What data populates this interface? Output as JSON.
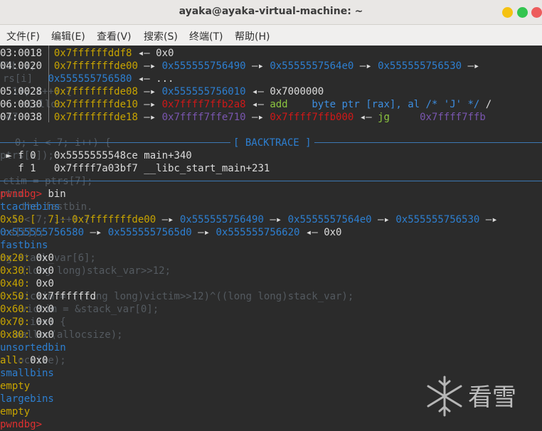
{
  "window": {
    "title": "ayaka@ayaka-virtual-machine: ~"
  },
  "menu": [
    "文件(F)",
    "编辑(E)",
    "查看(V)",
    "搜索(S)",
    "终端(T)",
    "帮助(H)"
  ],
  "stack": [
    {
      "off": "03:0018",
      "addr": "0x7ffffffddf8",
      "rest": [
        [
          "w",
          "◂— 0x0"
        ]
      ]
    },
    {
      "off": "04:0020",
      "addr": "0x7fffffffde00",
      "rest": [
        [
          "w",
          "—▸ "
        ],
        [
          "b",
          "0x555555756490"
        ],
        [
          "w",
          " —▸ "
        ],
        [
          "b",
          "0x5555557564e0"
        ],
        [
          "w",
          " —▸ "
        ],
        [
          "b",
          "0x555555756530"
        ],
        [
          "w",
          " —▸"
        ]
      ]
    },
    {
      "off": "",
      "addr": "",
      "rest": [
        [
          "b",
          "0x555555756580"
        ],
        [
          "w",
          " ◂— ..."
        ]
      ]
    },
    {
      "off": "05:0028",
      "addr": "0x7fffffffde08",
      "rest": [
        [
          "w",
          "—▸ "
        ],
        [
          "b",
          "0x555555756010"
        ],
        [
          "w",
          " ◂— 0x7000000"
        ]
      ]
    },
    {
      "off": "06:0030",
      "addr": "0x7fffffffde10",
      "rest": [
        [
          "w",
          "—▸ "
        ],
        [
          "r",
          "0x7ffff7ffb2a8"
        ],
        [
          "w",
          " ◂— "
        ],
        [
          "gr",
          "add"
        ],
        [
          "w",
          "    "
        ],
        [
          "bl",
          "byte ptr [rax], al /* 'J' */"
        ],
        [
          "w",
          " /"
        ]
      ]
    },
    {
      "off": "07:0038",
      "addr": "0x7fffffffde18",
      "rest": [
        [
          "w",
          "—▸ "
        ],
        [
          "m",
          "0x7ffff7ffe710"
        ],
        [
          "w",
          " —▸ "
        ],
        [
          "r",
          "0x7ffff7ffb000"
        ],
        [
          "w",
          " ◂— "
        ],
        [
          "gr",
          "jg"
        ],
        [
          "w",
          "     "
        ],
        [
          "m",
          "0x7ffff7ffb"
        ]
      ]
    }
  ],
  "backtrace": {
    "header": "[ BACKTRACE ]",
    "frames": [
      {
        "marker": "►",
        "idx": "f 0",
        "addr": "0x5555555548ce",
        "sym": "main+340"
      },
      {
        "marker": "",
        "idx": "f 1",
        "addr": "0x7ffff7a03bf7",
        "sym": "__libc_start_main+231"
      }
    ]
  },
  "prompt": "pwndbg>",
  "command": "bin",
  "tcache": {
    "header": "tcachebins",
    "line1": [
      [
        "y",
        "0x50 [  7]: 0x7fffffffde00"
      ],
      [
        "w",
        " —▸ "
      ],
      [
        "b",
        "0x555555756490"
      ],
      [
        "w",
        " —▸ "
      ],
      [
        "b",
        "0x5555557564e0"
      ],
      [
        "w",
        " —▸ "
      ],
      [
        "b",
        "0x555555756530"
      ],
      [
        "w",
        " —▸"
      ]
    ],
    "line2": [
      [
        "b",
        "0x555555756580"
      ],
      [
        "w",
        " —▸ "
      ],
      [
        "b",
        "0x5555557565d0"
      ],
      [
        "w",
        " —▸ "
      ],
      [
        "b",
        "0x555555756620"
      ],
      [
        "w",
        " ◂— 0x0"
      ]
    ]
  },
  "fastbins": {
    "header": "fastbins",
    "entries": [
      {
        "size": "0x20:",
        "val": " 0x0"
      },
      {
        "size": "0x30:",
        "val": " 0x0"
      },
      {
        "size": "0x40:",
        "val": " 0x0"
      },
      {
        "size": "0x50:",
        "val": " 0x7ffffffd"
      },
      {
        "size": "0x60:",
        "val": " 0x0"
      },
      {
        "size": "0x70:",
        "val": " 0x0"
      },
      {
        "size": "0x80:",
        "val": " 0x0"
      }
    ]
  },
  "unsorted": {
    "header": "unsortedbin",
    "label": "all:",
    "val": " 0x0"
  },
  "smallbins": {
    "header": "smallbins",
    "val": "empty"
  },
  "largebins": {
    "header": "largebins",
    "val": "empty"
  },
  "final_prompt": "pwndbg>",
  "ghost_source": [
    "NULL);",
    "rs[i] ",
    "  14; i++) {",
    "   c(alloc",
    "047",
    "  0; i < 7; i++) {",
    "ptrs[i]);",
    "ctim = ptrs[7];",
    "rtim",
    "   the fastbin.",
    "  i < 7; i++) {",
    "rs[i]);",
    "ng stack_var[6];",
    "   (long long)stack_var>>12;",
    "   victim = ((long long)victim>>12)^((long long)stack_var);",
    "   victim = &stack_var[0];",
    "   ; i++) {",
    "  malloc(allocsize);",
    "allocsize);"
  ],
  "watermark": "看雪"
}
